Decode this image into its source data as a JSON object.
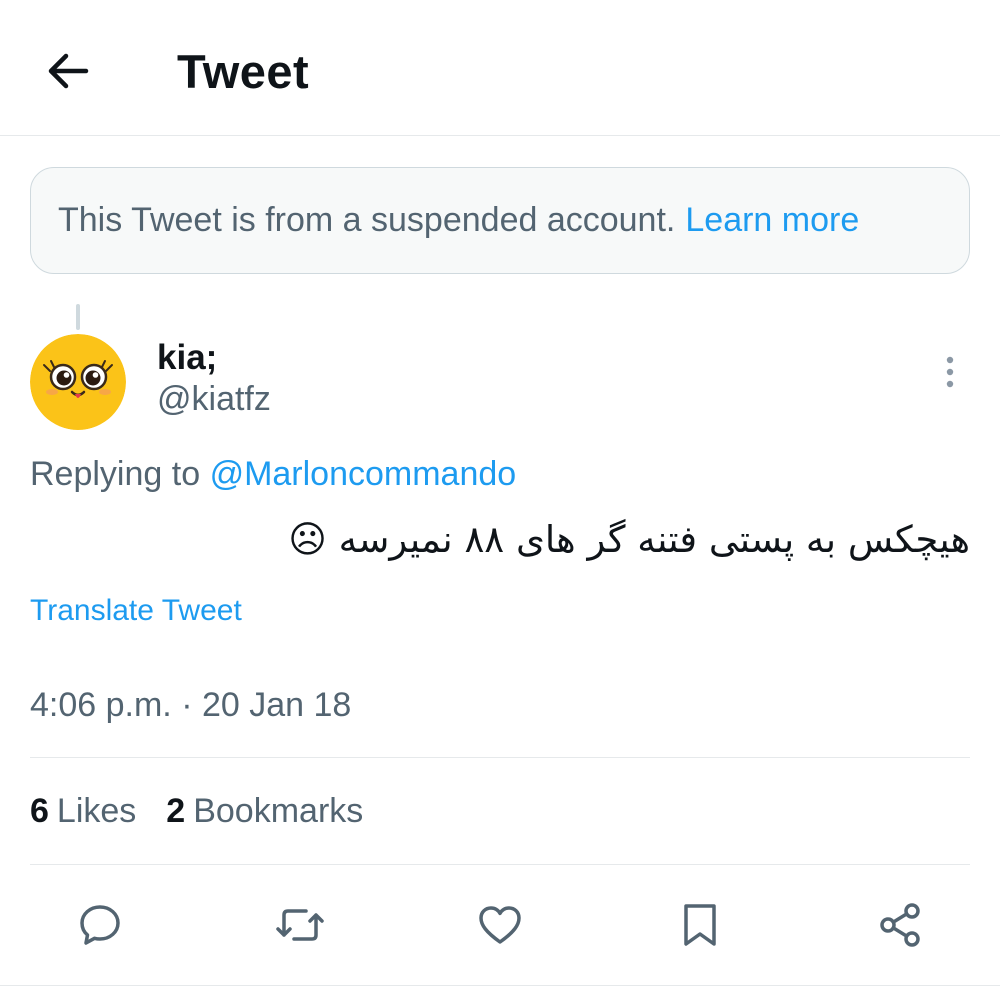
{
  "header": {
    "title": "Tweet",
    "back_icon": "arrow-left-icon"
  },
  "notice": {
    "text": "This Tweet is from a suspended account.",
    "link": "Learn more"
  },
  "tweet": {
    "author": {
      "display_name": "kia;",
      "handle": "@kiatfz",
      "avatar": "smiling-face-avatar"
    },
    "replying_to_label": "Replying to",
    "replying_to_handle": "@Marloncommando",
    "text": "هیچکس به پستی فتنه گر های ۸۸ نمیرسه ☹",
    "translate_label": "Translate Tweet",
    "timestamp": "4:06 p.m. · 20 Jan 18"
  },
  "stats": {
    "likes_count": "6",
    "likes_label": "Likes",
    "bookmarks_count": "2",
    "bookmarks_label": "Bookmarks"
  },
  "actions": [
    "reply-icon",
    "retweet-icon",
    "like-icon",
    "bookmark-icon",
    "share-icon"
  ],
  "colors": {
    "accent": "#1d9bf0",
    "text_primary": "#0f1419",
    "text_secondary": "#536471",
    "avatar_yellow": "#fbc318"
  }
}
